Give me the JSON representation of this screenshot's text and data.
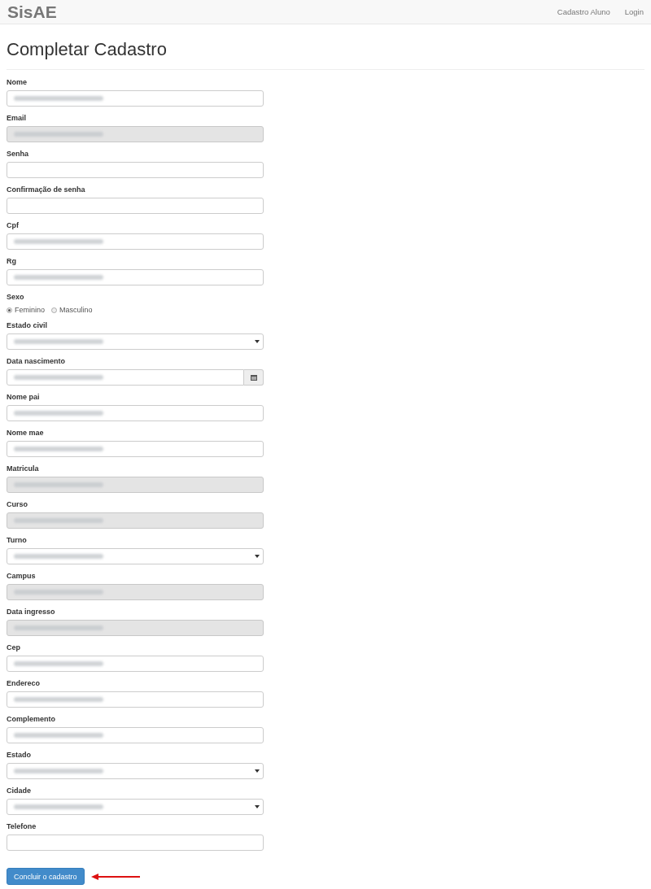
{
  "navbar": {
    "brand": "SisAE",
    "links": [
      "Cadastro Aluno",
      "Login"
    ]
  },
  "title": "Completar Cadastro",
  "fields": [
    {
      "kind": "text",
      "label": "Nome",
      "disabled": false,
      "blurred": true
    },
    {
      "kind": "text",
      "label": "Email",
      "disabled": true,
      "blurred": true
    },
    {
      "kind": "text",
      "label": "Senha",
      "disabled": false,
      "blurred": false
    },
    {
      "kind": "text",
      "label": "Confirmação de senha",
      "disabled": false,
      "blurred": false
    },
    {
      "kind": "text",
      "label": "Cpf",
      "disabled": false,
      "blurred": true
    },
    {
      "kind": "text",
      "label": "Rg",
      "disabled": false,
      "blurred": true
    },
    {
      "kind": "radio",
      "label": "Sexo",
      "options": [
        {
          "label": "Feminino",
          "selected": true
        },
        {
          "label": "Masculino",
          "selected": false
        }
      ]
    },
    {
      "kind": "select",
      "label": "Estado civil",
      "disabled": false,
      "blurred": true
    },
    {
      "kind": "date",
      "label": "Data nascimento",
      "disabled": false,
      "blurred": true
    },
    {
      "kind": "text",
      "label": "Nome pai",
      "disabled": false,
      "blurred": true
    },
    {
      "kind": "text",
      "label": "Nome mae",
      "disabled": false,
      "blurred": true
    },
    {
      "kind": "text",
      "label": "Matricula",
      "disabled": true,
      "blurred": true
    },
    {
      "kind": "text",
      "label": "Curso",
      "disabled": true,
      "blurred": true
    },
    {
      "kind": "select",
      "label": "Turno",
      "disabled": false,
      "blurred": true
    },
    {
      "kind": "text",
      "label": "Campus",
      "disabled": true,
      "blurred": true
    },
    {
      "kind": "text",
      "label": "Data ingresso",
      "disabled": true,
      "blurred": true
    },
    {
      "kind": "text",
      "label": "Cep",
      "disabled": false,
      "blurred": true
    },
    {
      "kind": "text",
      "label": "Endereco",
      "disabled": false,
      "blurred": true
    },
    {
      "kind": "text",
      "label": "Complemento",
      "disabled": false,
      "blurred": true
    },
    {
      "kind": "select",
      "label": "Estado",
      "disabled": false,
      "blurred": true
    },
    {
      "kind": "select",
      "label": "Cidade",
      "disabled": false,
      "blurred": true
    },
    {
      "kind": "text",
      "label": "Telefone",
      "disabled": false,
      "blurred": false
    }
  ],
  "submit": {
    "label": "Concluir o cadastro"
  }
}
